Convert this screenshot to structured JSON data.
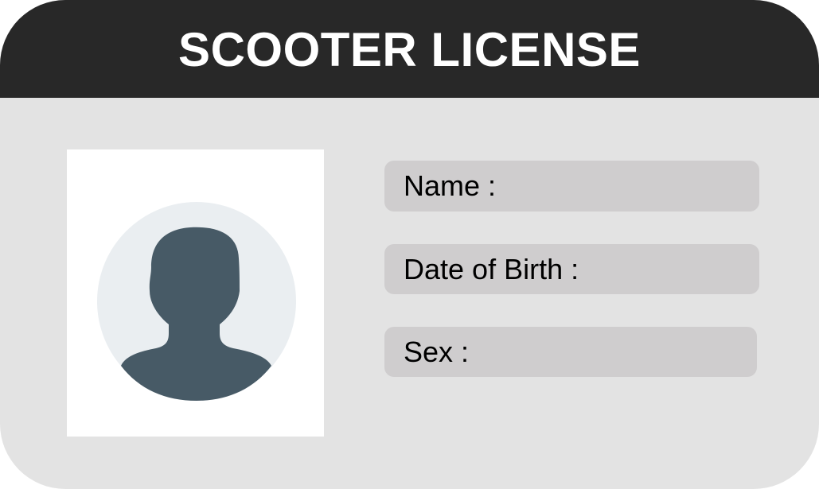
{
  "card": {
    "title": "SCOOTER LICENSE",
    "colors": {
      "header": "#282828",
      "body": "#e3e3e3",
      "field": "#cfcdce",
      "avatar_bg": "#eaeef1",
      "avatar_figure": "#475a66"
    },
    "photo": {
      "icon": "user-silhouette-icon"
    },
    "fields": {
      "name_label": "Name :",
      "dob_label": "Date of Birth :",
      "sex_label": "Sex :"
    }
  }
}
